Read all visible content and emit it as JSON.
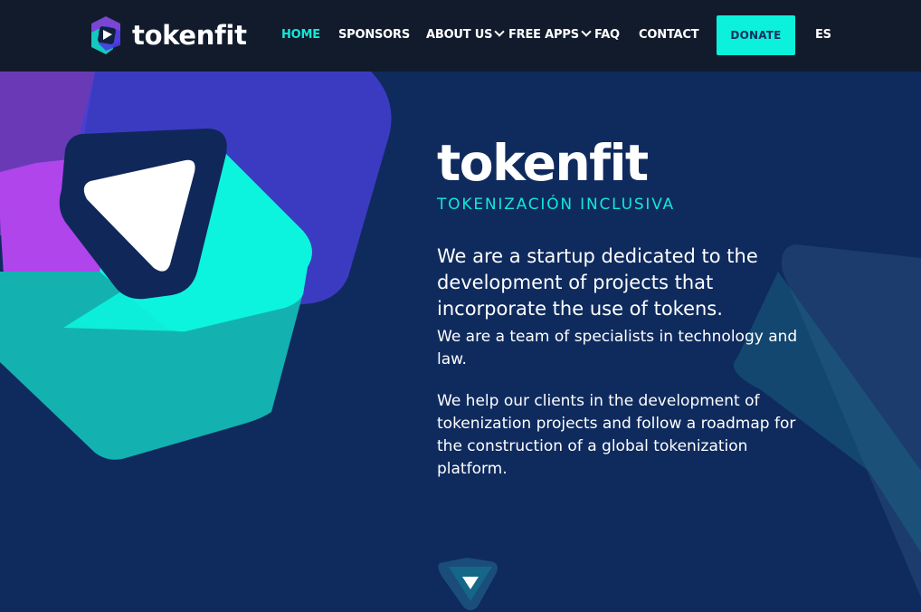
{
  "header": {
    "logo_text": "tokenfit",
    "nav": [
      {
        "label": "HOME",
        "active": true
      },
      {
        "label": "SPONSORS",
        "active": false
      },
      {
        "label": "ABOUT US",
        "active": false,
        "dropdown": true
      },
      {
        "label": "FREE APPS",
        "active": false,
        "dropdown": true
      },
      {
        "label": "FAQ",
        "active": false
      },
      {
        "label": "CONTACT",
        "active": false
      }
    ],
    "donate_label": "DONATE",
    "language": "ES"
  },
  "hero": {
    "title": "tokenfit",
    "tagline": "TOKENIZACIÓN INCLUSIVA",
    "lead": "We are a startup dedicated to the development of projects that incorporate the use of tokens.",
    "paragraph_1": "We are a team of specialists in technology and law.",
    "paragraph_2": "We help our clients in the development of tokenization projects and follow a roadmap for the construction of a global tokenization platform."
  },
  "icons": {
    "logo": "tokenfit-logo-icon",
    "dropdown": "chevron-down-icon",
    "scroll": "arrow-down-icon"
  },
  "colors": {
    "header_bg": "#121b2c",
    "hero_bg": "#0f2b5e",
    "accent_teal": "#0cf1dc",
    "accent_purple": "#a742e8",
    "accent_indigo": "#4338d8",
    "text": "#ffffff"
  }
}
